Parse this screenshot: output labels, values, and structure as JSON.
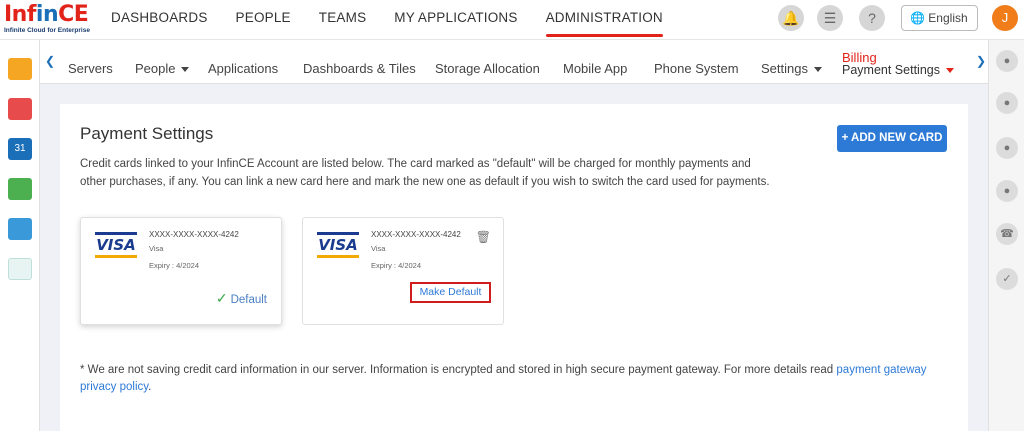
{
  "brand": {
    "logo_main": "Inf",
    "logo_in": "in",
    "logo_ce": "CE",
    "tagline": "Infinite Cloud for Enterprise"
  },
  "topnav": {
    "items": [
      "DASHBOARDS",
      "PEOPLE",
      "TEAMS",
      "MY APPLICATIONS",
      "ADMINISTRATION"
    ],
    "active": "ADMINISTRATION"
  },
  "header_right": {
    "language": "English",
    "avatar_initial": "J",
    "icons": [
      "bell-icon",
      "notes-icon",
      "help-icon",
      "globe-icon"
    ]
  },
  "subnav": {
    "items": [
      "Servers",
      "People",
      "Applications",
      "Dashboards & Tiles",
      "Storage Allocation",
      "Mobile App",
      "Phone System",
      "Settings"
    ],
    "billing_top": "Billing",
    "billing_sub": "Payment Settings"
  },
  "page": {
    "title": "Payment Settings",
    "add_button": "+ ADD NEW CARD",
    "description": "Credit cards linked to your InfinCE Account are listed below. The card marked as \"default\" will be charged for monthly payments and other purchases, if any. You can link a new card here and mark the new one as default if you wish to switch the card used for payments."
  },
  "cards": [
    {
      "number": "XXXX-XXXX-XXXX-4242",
      "brand": "Visa",
      "expiry": "Expiry : 4/2024",
      "status": "Default",
      "logo": "VISA"
    },
    {
      "number": "XXXX-XXXX-XXXX-4242",
      "brand": "Visa",
      "expiry": "Expiry : 4/2024",
      "action": "Make Default",
      "logo": "VISA"
    }
  ],
  "footnote": {
    "text": "* We are not saving credit card information in our server. Information is encrypted and stored in high secure payment gateway. For more details read ",
    "link": "payment gateway privacy policy",
    "end": "."
  },
  "colors": {
    "accent_red": "#e2231a",
    "primary_blue": "#2d7ad6",
    "visa_blue": "#1a3b8f",
    "visa_gold": "#f2a900"
  }
}
